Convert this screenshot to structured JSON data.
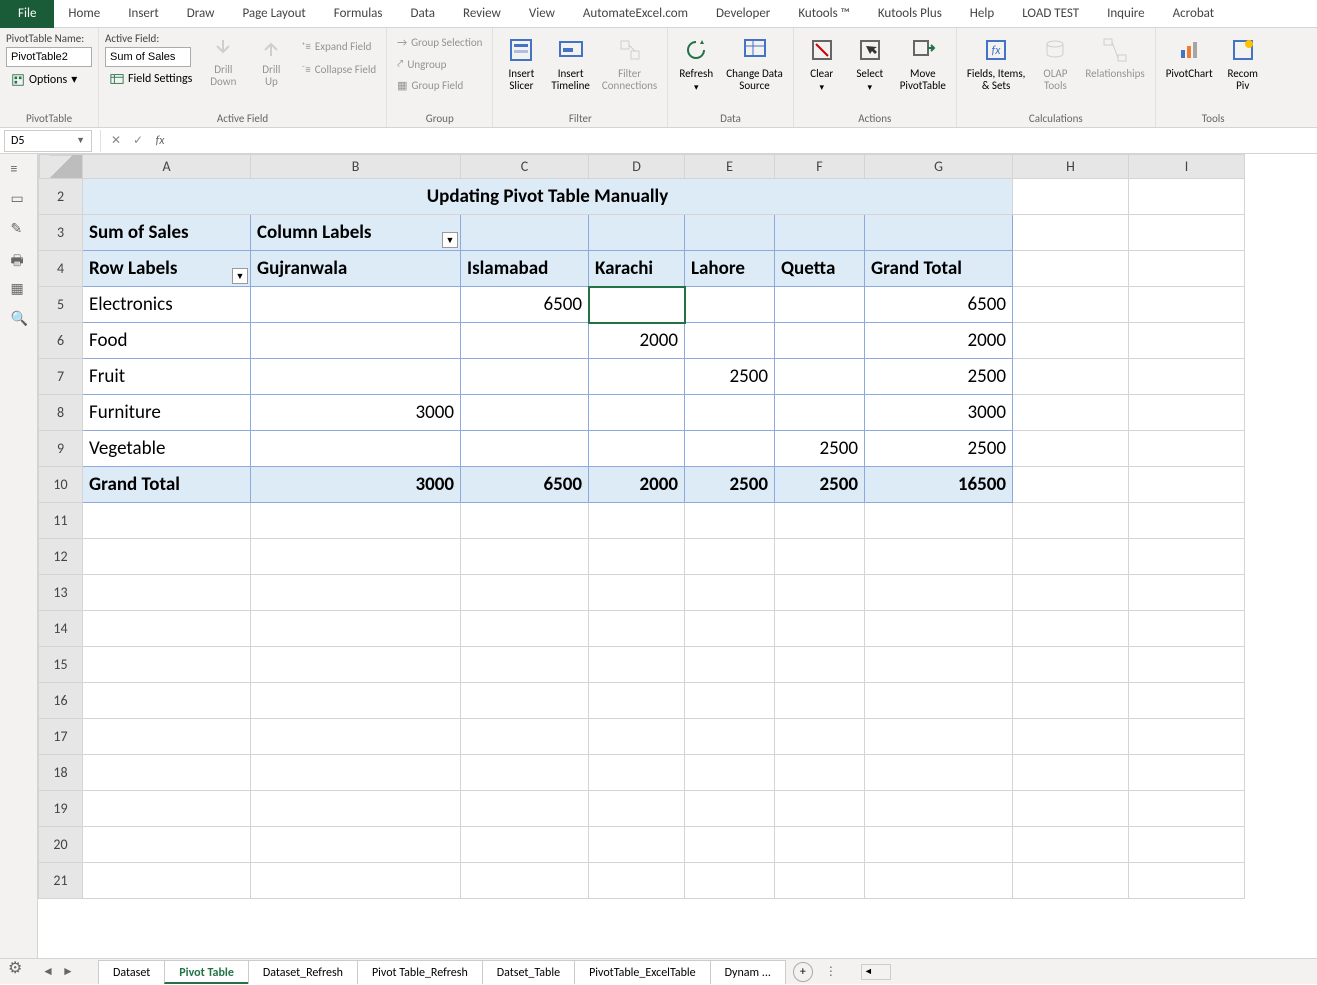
{
  "menu_tabs": [
    "File",
    "Home",
    "Insert",
    "Draw",
    "Page Layout",
    "Formulas",
    "Data",
    "Review",
    "View",
    "AutomateExcel.com",
    "Developer",
    "Kutools ™",
    "Kutools Plus",
    "Help",
    "LOAD TEST",
    "Inquire",
    "Acrobat"
  ],
  "ribbon": {
    "pivot_table": {
      "label": "PivotTable",
      "name_label": "PivotTable Name:",
      "name_value": "PivotTable2",
      "options_label": "Options"
    },
    "active_field": {
      "label": "Active Field",
      "name_label": "Active Field:",
      "value": "Sum of Sales",
      "field_settings": "Field Settings",
      "drill_down": "Drill\nDown",
      "drill_up": "Drill\nUp",
      "expand": "Expand Field",
      "collapse": "Collapse Field"
    },
    "group": {
      "label": "Group",
      "selection": "Group Selection",
      "ungroup": "Ungroup",
      "group_field": "Group Field"
    },
    "filter": {
      "label": "Filter",
      "insert_slicer": "Insert\nSlicer",
      "insert_timeline": "Insert\nTimeline",
      "filter_connections": "Filter\nConnections"
    },
    "data": {
      "label": "Data",
      "refresh": "Refresh",
      "change_source": "Change Data\nSource"
    },
    "actions": {
      "label": "Actions",
      "clear": "Clear",
      "select": "Select",
      "move": "Move\nPivotTable"
    },
    "calculations": {
      "label": "Calculations",
      "fields": "Fields, Items,\n& Sets",
      "olap": "OLAP\nTools",
      "relationships": "Relationships"
    },
    "tools": {
      "label": "Tools",
      "pivotchart": "PivotChart",
      "recommended": "Recom\nPiv"
    }
  },
  "name_box": "D5",
  "formula_value": "",
  "columns": [
    "A",
    "B",
    "C",
    "D",
    "E",
    "F",
    "G",
    "H",
    "I"
  ],
  "rows": [
    "2",
    "3",
    "4",
    "5",
    "6",
    "7",
    "8",
    "9",
    "10",
    "11",
    "12",
    "13",
    "14",
    "15",
    "16",
    "17",
    "18",
    "19",
    "20",
    "21"
  ],
  "sheet": {
    "title": "Updating Pivot Table Manually",
    "corner_label": "Sum of Sales",
    "col_labels_hdr": "Column Labels",
    "row_labels_hdr": "Row Labels",
    "col_headers": [
      "Gujranwala",
      "Islamabad",
      "Karachi",
      "Lahore",
      "Quetta"
    ],
    "grand_total_label": "Grand Total",
    "rows_data": [
      {
        "label": "Electronics",
        "vals": [
          "",
          "6500",
          "",
          "",
          "",
          ""
        ],
        "total": "6500"
      },
      {
        "label": "Food",
        "vals": [
          "",
          "",
          "2000",
          "",
          "",
          ""
        ],
        "total": "2000"
      },
      {
        "label": "Fruit",
        "vals": [
          "",
          "",
          "",
          "2500",
          "",
          ""
        ],
        "total": "2500"
      },
      {
        "label": "Furniture",
        "vals": [
          "3000",
          "",
          "",
          "",
          "",
          ""
        ],
        "total": "3000"
      },
      {
        "label": "Vegetable",
        "vals": [
          "",
          "",
          "",
          "",
          "2500",
          ""
        ],
        "total": "2500"
      }
    ],
    "col_totals": [
      "3000",
      "6500",
      "2000",
      "2500",
      "2500"
    ],
    "grand_total": "16500"
  },
  "sheet_tabs": [
    "Dataset",
    "Pivot Table",
    "Dataset_Refresh",
    "Pivot Table_Refresh",
    "Datset_Table",
    "PivotTable_ExcelTable",
    "Dynam ..."
  ],
  "active_sheet_tab": 1,
  "active_cell": "D5"
}
